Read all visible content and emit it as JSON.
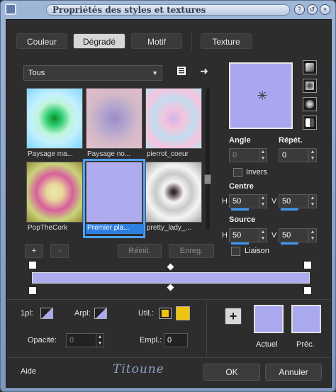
{
  "window": {
    "title": "Propriétés des styles et textures"
  },
  "tabs": [
    {
      "label": "Couleur",
      "active": false
    },
    {
      "label": "Dégradé",
      "active": true
    },
    {
      "label": "Motif",
      "active": false
    },
    {
      "label": "Texture",
      "active": false
    }
  ],
  "category_select": {
    "value": "Tous"
  },
  "gradients": [
    {
      "label": "Paysage ma..."
    },
    {
      "label": "Paysage no..."
    },
    {
      "label": "pierrot_coeur"
    },
    {
      "label": "PopTheCork"
    },
    {
      "label": "Premier pla...",
      "selected": true
    },
    {
      "label": "pretty_lady_..."
    }
  ],
  "list_buttons": {
    "add": "+",
    "remove": "-",
    "reset": "Réinit.",
    "save": "Enreg."
  },
  "params": {
    "angle_label": "Angle",
    "angle_value": "0",
    "repeat_label": "Répét.",
    "repeat_value": "0",
    "invert_label": "Invers",
    "center_label": "Centre",
    "center_h": "50",
    "center_v": "50",
    "source_label": "Source",
    "source_h": "50",
    "source_v": "50",
    "link_label": "Liaison",
    "h": "H",
    "v": "V"
  },
  "stop_panel": {
    "first_label": "1pl:",
    "back_label": "Arpl:",
    "user_label": "Util.:",
    "opacity_label": "Opacité:",
    "opacity_value": "0",
    "location_label": "Empl.:",
    "location_value": "0"
  },
  "swatches": {
    "current_label": "Actuel",
    "previous_label": "Préc.",
    "add": "+"
  },
  "footer": {
    "help": "Aide",
    "logo": "Titoune",
    "ok": "OK",
    "cancel": "Annuler"
  },
  "colors": {
    "gradient": "#aeacee",
    "accent": "#2f7fe0",
    "user_color": "#f1c40f"
  }
}
